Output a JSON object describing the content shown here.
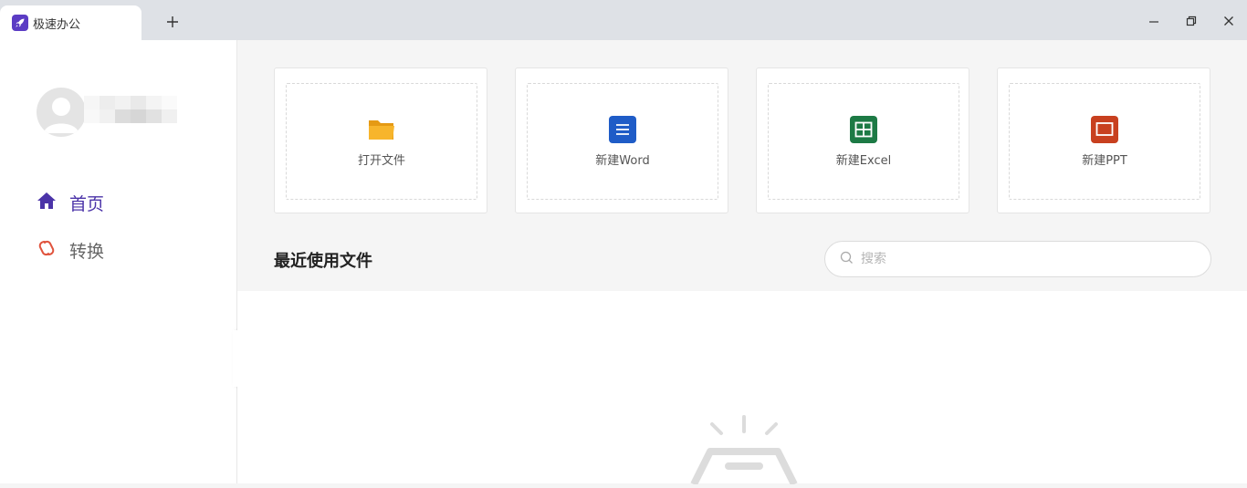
{
  "titlebar": {
    "tab_title": "极速办公",
    "icons": [
      "rocket-icon",
      "plus-icon",
      "minimize-icon",
      "restore-icon",
      "close-icon"
    ]
  },
  "sidebar": {
    "nav": [
      {
        "label": "首页",
        "icon": "home-icon",
        "active": true
      },
      {
        "label": "转换",
        "icon": "convert-icon",
        "active": false
      }
    ],
    "accent": "#4b33a8"
  },
  "actions": [
    {
      "label": "打开文件",
      "icon": "folder-icon",
      "color": "#f5a623"
    },
    {
      "label": "新建Word",
      "icon": "word-icon",
      "color": "#1f5cc7"
    },
    {
      "label": "新建Excel",
      "icon": "excel-icon",
      "color": "#1d7a45"
    },
    {
      "label": "新建PPT",
      "icon": "ppt-icon",
      "color": "#c8401f"
    }
  ],
  "recent": {
    "title": "最近使用文件",
    "search_placeholder": "搜索",
    "search_value": ""
  }
}
